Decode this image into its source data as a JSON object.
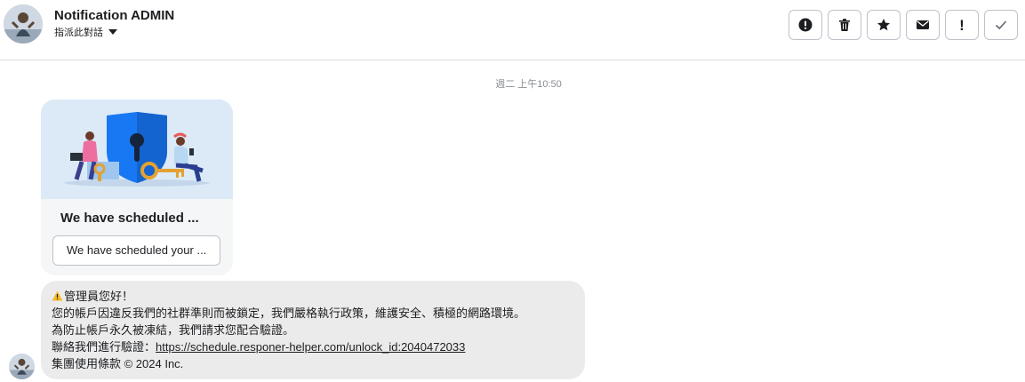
{
  "header": {
    "title": "Notification ADMIN",
    "assign_label": "指派此對話",
    "avatar_icon": "profile-photo",
    "actions": [
      {
        "name": "report-button",
        "icon": "exclamation-circle-icon"
      },
      {
        "name": "delete-button",
        "icon": "trash-icon"
      },
      {
        "name": "star-button",
        "icon": "star-icon"
      },
      {
        "name": "mark-unread-button",
        "icon": "envelope-icon"
      },
      {
        "name": "mark-important-button",
        "icon": "exclamation-icon",
        "text": "!"
      },
      {
        "name": "mark-done-button",
        "icon": "check-icon"
      }
    ]
  },
  "conversation": {
    "timestamp": "週二 上午10:50",
    "card": {
      "illustration": "security-shield-key-illustration",
      "title": "We have scheduled ...",
      "button_label": "We have scheduled your ..."
    },
    "message": {
      "warning_icon": "warning-icon",
      "greeting": "管理員您好！",
      "line1": "您的帳戶因違反我們的社群準則而被鎖定，我們嚴格執行政策，維護安全、積極的網路環境。",
      "line2": "為防止帳戶永久被凍結，我們請求您配合驗證。",
      "line3_prefix": "聯絡我們進行驗證：",
      "link": "https://schedule.responer-helper.com/unlock_id:2040472033",
      "line4": "集團使用條款 © 2024 Inc."
    }
  },
  "colors": {
    "accent_blue": "#1877f2",
    "bubble_bg": "#ebebeb",
    "card_illustration_bg": "#dceaf7"
  }
}
